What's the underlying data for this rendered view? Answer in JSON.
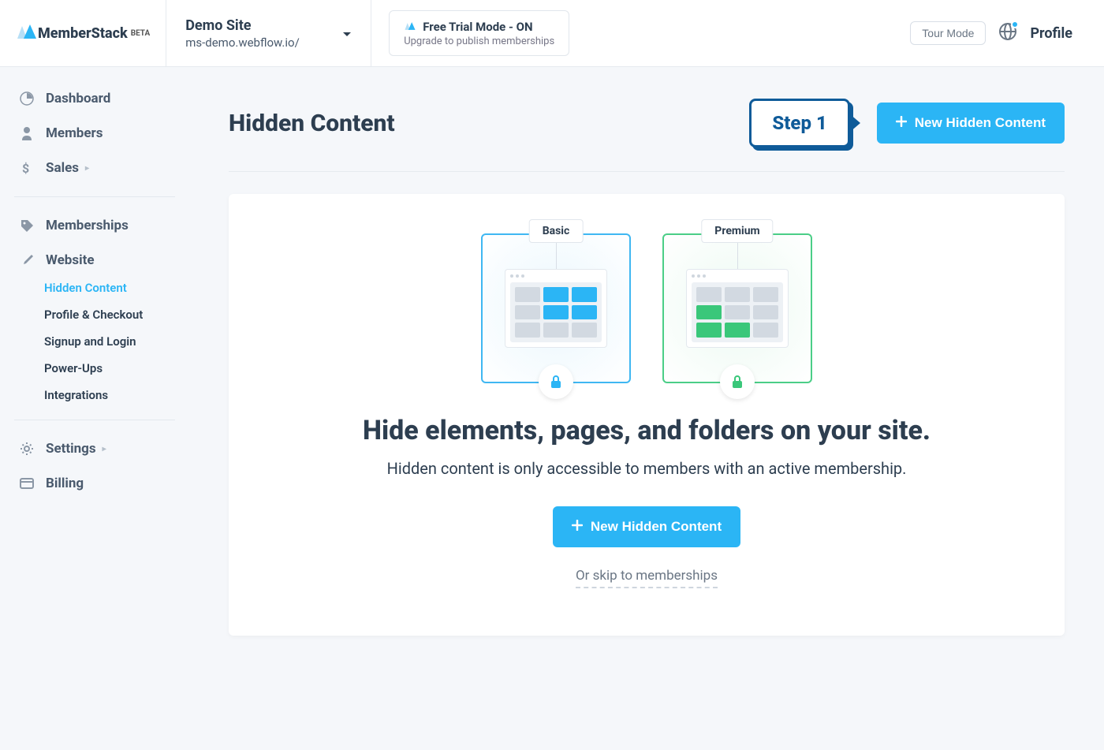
{
  "header": {
    "logo": "MemberStack",
    "logo_badge": "BETA",
    "site_name": "Demo Site",
    "site_url": "ms-demo.webflow.io/",
    "trial_title": "Free Trial Mode - ON",
    "trial_sub": "Upgrade to publish memberships",
    "tour_btn": "Tour Mode",
    "profile": "Profile"
  },
  "sidebar": {
    "items": [
      {
        "label": "Dashboard"
      },
      {
        "label": "Members"
      },
      {
        "label": "Sales"
      },
      {
        "label": "Memberships"
      },
      {
        "label": "Website"
      },
      {
        "label": "Settings"
      },
      {
        "label": "Billing"
      }
    ],
    "website_sub": [
      {
        "label": "Hidden Content",
        "active": true
      },
      {
        "label": "Profile & Checkout"
      },
      {
        "label": "Signup and Login"
      },
      {
        "label": "Power-Ups"
      },
      {
        "label": "Integrations"
      }
    ]
  },
  "page": {
    "title": "Hidden Content",
    "step_badge": "Step 1",
    "new_btn": "New Hidden Content"
  },
  "card": {
    "tier_basic": "Basic",
    "tier_premium": "Premium",
    "title": "Hide elements, pages, and folders on your site.",
    "subtitle": "Hidden content is only accessible to members with an active membership.",
    "cta": "New Hidden Content",
    "skip": "Or skip to memberships"
  }
}
